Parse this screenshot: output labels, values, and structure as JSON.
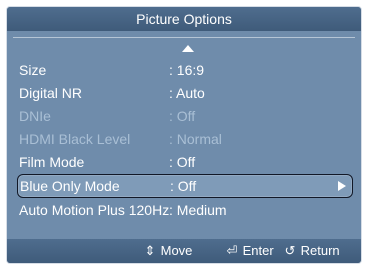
{
  "title": "Picture Options",
  "menu": {
    "items": [
      {
        "label": "Size",
        "value": ": 16:9",
        "state": "normal"
      },
      {
        "label": "Digital NR",
        "value": ": Auto",
        "state": "normal"
      },
      {
        "label": "DNIe",
        "value": ": Off",
        "state": "disabled"
      },
      {
        "label": "HDMI Black Level",
        "value": ": Normal",
        "state": "disabled"
      },
      {
        "label": "Film Mode",
        "value": ": Off",
        "state": "normal"
      },
      {
        "label": "Blue Only Mode",
        "value": ": Off",
        "state": "selected"
      },
      {
        "label": "Auto Motion Plus 120Hz",
        "value": ": Medium",
        "state": "normal"
      }
    ]
  },
  "footer": {
    "move": {
      "icon": "up-down-arrows-icon",
      "label": "Move"
    },
    "enter": {
      "icon": "enter-icon",
      "label": "Enter"
    },
    "return": {
      "icon": "return-icon",
      "label": "Return"
    }
  }
}
